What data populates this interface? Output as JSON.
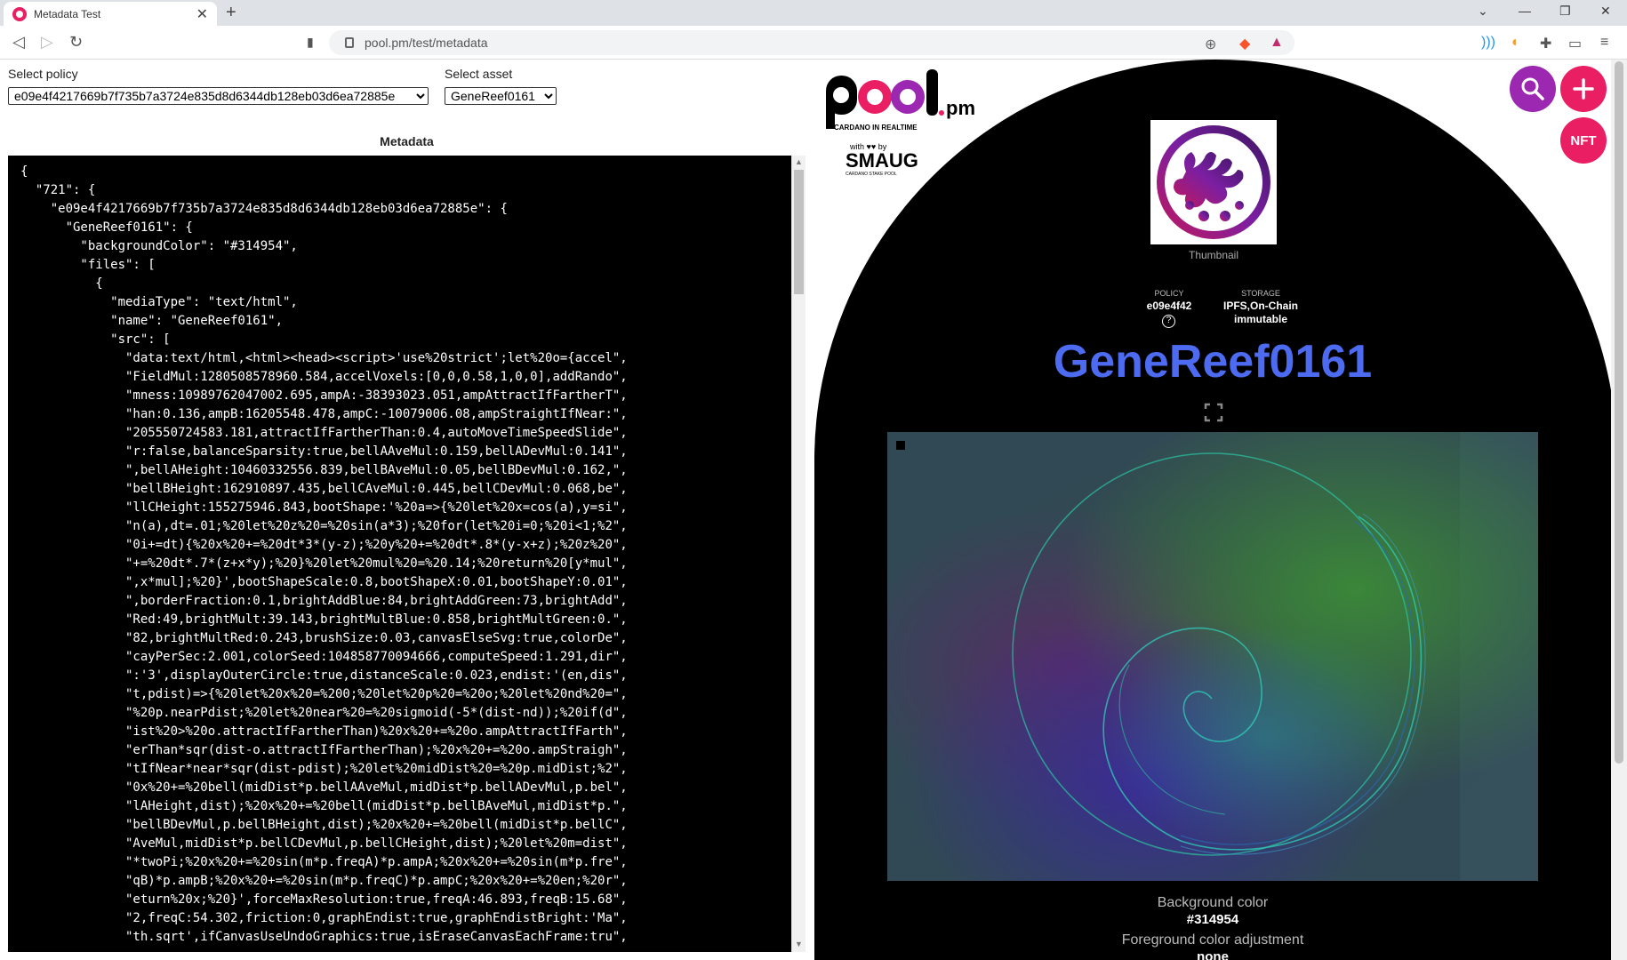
{
  "browser": {
    "tab_title": "Metadata Test",
    "url": "pool.pm/test/metadata"
  },
  "left": {
    "policy_label": "Select policy",
    "policy_value": "e09e4f4217669b7f735b7a3724e835d8d6344db128eb03d6ea72885e",
    "asset_label": "Select asset",
    "asset_value": "GeneReef0161",
    "metadata_title": "Metadata",
    "metadata_lines": [
      "{",
      "  \"721\": {",
      "    \"e09e4f4217669b7f735b7a3724e835d8d6344db128eb03d6ea72885e\": {",
      "      \"GeneReef0161\": {",
      "        \"backgroundColor\": \"#314954\",",
      "        \"files\": [",
      "          {",
      "            \"mediaType\": \"text/html\",",
      "            \"name\": \"GeneReef0161\",",
      "            \"src\": [",
      "              \"data:text/html,<html><head><script>'use%20strict';let%20o={accel\",",
      "              \"FieldMul:1280508578960.584,accelVoxels:[0,0,0.58,1,0,0],addRando\",",
      "              \"mness:10989762047002.695,ampA:-38393023.051,ampAttractIfFartherT\",",
      "              \"han:0.136,ampB:16205548.478,ampC:-10079006.08,ampStraightIfNear:\",",
      "              \"205550724583.181,attractIfFartherThan:0.4,autoMoveTimeSpeedSlide\",",
      "              \"r:false,balanceSparsity:true,bellAAveMul:0.159,bellADevMul:0.141\",",
      "              \",bellAHeight:10460332556.839,bellBAveMul:0.05,bellBDevMul:0.162,\",",
      "              \"bellBHeight:162910897.435,bellCAveMul:0.445,bellCDevMul:0.068,be\",",
      "              \"llCHeight:155275946.843,bootShape:'%20a=>{%20let%20x=cos(a),y=si\",",
      "              \"n(a),dt=.01;%20let%20z%20=%20sin(a*3);%20for(let%20i=0;%20i<1;%2\",",
      "              \"0i+=dt){%20x%20+=%20dt*3*(y-z);%20y%20+=%20dt*.8*(y-x+z);%20z%20\",",
      "              \"+=%20dt*.7*(z+x*y);%20}%20let%20mul%20=%20.14;%20return%20[y*mul\",",
      "              \",x*mul];%20}',bootShapeScale:0.8,bootShapeX:0.01,bootShapeY:0.01\",",
      "              \",borderFraction:0.1,brightAddBlue:84,brightAddGreen:73,brightAdd\",",
      "              \"Red:49,brightMult:39.143,brightMultBlue:0.858,brightMultGreen:0.\",",
      "              \"82,brightMultRed:0.243,brushSize:0.03,canvasElseSvg:true,colorDe\",",
      "              \"cayPerSec:2.001,colorSeed:104858770094666,computeSpeed:1.291,dir\",",
      "              \":'3',displayOuterCircle:true,distanceScale:0.023,endist:'(en,dis\",",
      "              \"t,pdist)=>{%20let%20x%20=%200;%20let%20p%20=%20o;%20let%20nd%20=\",",
      "              \"%20p.nearPdist;%20let%20near%20=%20sigmoid(-5*(dist-nd));%20if(d\",",
      "              \"ist%20>%20o.attractIfFartherThan)%20x%20+=%20o.ampAttractIfFarth\",",
      "              \"erThan*sqr(dist-o.attractIfFartherThan);%20x%20+=%20o.ampStraigh\",",
      "              \"tIfNear*near*sqr(dist-pdist);%20let%20midDist%20=%20p.midDist;%2\",",
      "              \"0x%20+=%20bell(midDist*p.bellAAveMul,midDist*p.bellADevMul,p.bel\",",
      "              \"lAHeight,dist);%20x%20+=%20bell(midDist*p.bellBAveMul,midDist*p.\",",
      "              \"bellBDevMul,p.bellBHeight,dist);%20x%20+=%20bell(midDist*p.bellC\",",
      "              \"AveMul,midDist*p.bellCDevMul,p.bellCHeight,dist);%20let%20m=dist\",",
      "              \"*twoPi;%20x%20+=%20sin(m*p.freqA)*p.ampA;%20x%20+=%20sin(m*p.fre\",",
      "              \"qB)*p.ampB;%20x%20+=%20sin(m*p.freqC)*p.ampC;%20x%20+=%20en;%20r\",",
      "              \"eturn%20x;%20}',forceMaxResolution:true,freqA:46.893,freqB:15.68\",",
      "              \"2,freqC:54.302,friction:0,graphEndist:true,graphEndistBright:'Ma\",",
      "              \"th.sqrt',ifCanvasUseUndoGraphics:true,isEraseCanvasEachFrame:tru\","
    ]
  },
  "right": {
    "logo_text": "pool.pm",
    "logo_tagline": "CARDANO IN REALTIME",
    "logo_with_by": "with ♥♥ by",
    "smaug_label": "SMAUG",
    "smaug_sub": "CARDANO STAKE POOL",
    "search_icon": "search-icon",
    "plus_icon": "plus-icon",
    "nft_label": "NFT",
    "thumbnail_label": "Thumbnail",
    "policy_label": "POLICY",
    "policy_value": "e09e4f42",
    "storage_label": "STORAGE",
    "storage_value": "IPFS,On-Chain",
    "storage_sub": "immutable",
    "asset_title": "GeneReef0161",
    "background_color_label": "Background color",
    "background_color_value": "#314954",
    "fg_adjust_label": "Foreground color adjustment",
    "fg_adjust_value": "none"
  },
  "colors": {
    "accent_pink": "#e91e63",
    "accent_purple": "#9c27b0",
    "title_blue": "#4d6bf0",
    "art_background": "#314954"
  }
}
